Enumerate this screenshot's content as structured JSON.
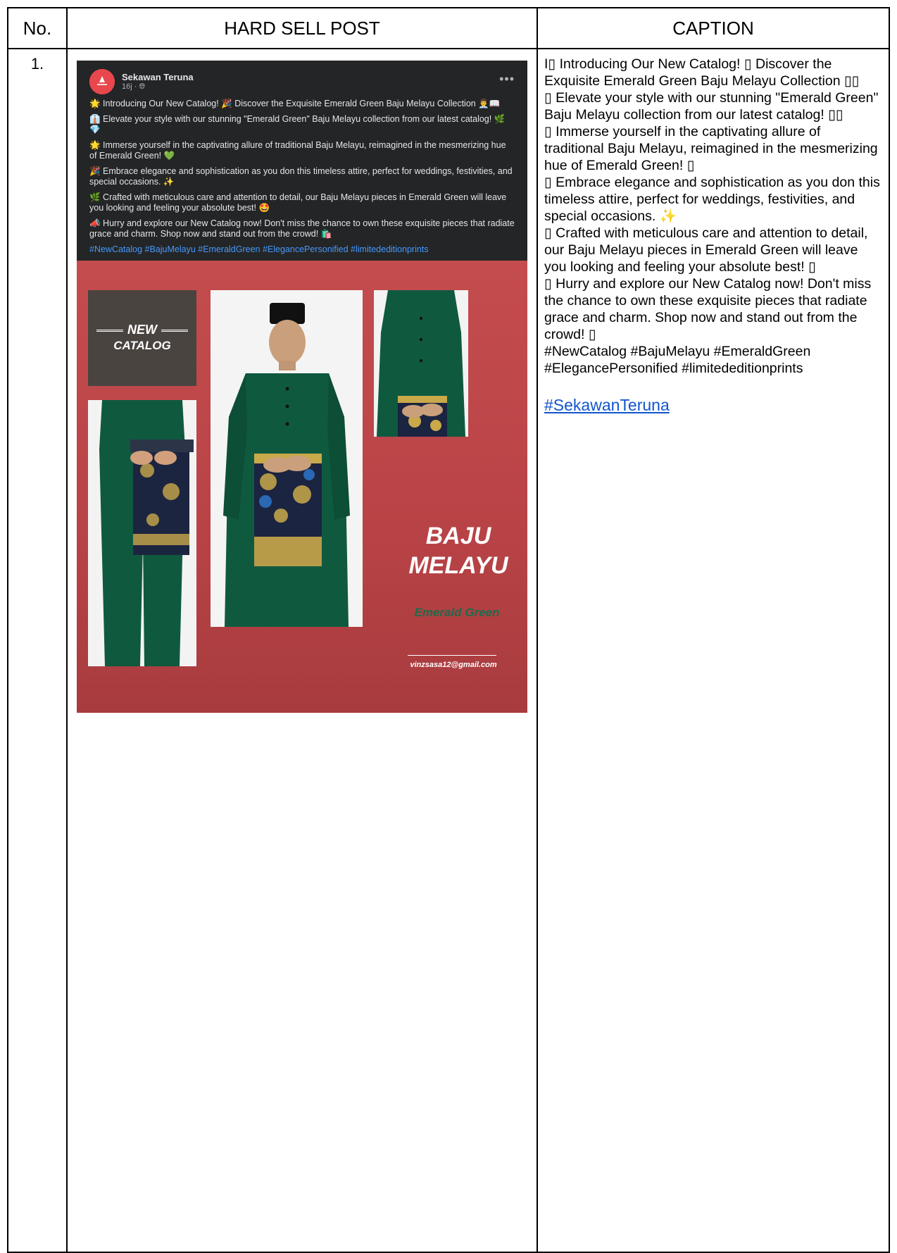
{
  "table": {
    "headers": {
      "no": "No.",
      "post": "HARD SELL POST",
      "caption": "CAPTION"
    },
    "row": {
      "no": "1."
    }
  },
  "post": {
    "page_name": "Sekawan Teruna",
    "avatar_text": "SEKAWAN TERUNA",
    "meta": "16j · ",
    "more": "•••",
    "paragraphs": [
      "🌟 Introducing Our New Catalog! 🎉 Discover the Exquisite Emerald Green Baju Melayu Collection 👨‍💼📖",
      "👔 Elevate your style with our stunning \"Emerald Green\" Baju Melayu collection from our latest catalog! 🌿💎",
      "🌟 Immerse yourself in the captivating allure of traditional Baju Melayu, reimagined in the mesmerizing hue of Emerald Green! 💚",
      "🎉 Embrace elegance and sophistication as you don this timeless attire, perfect for weddings, festivities, and special occasions. ✨",
      "🌿 Crafted with meticulous care and attention to detail, our Baju Melayu pieces in Emerald Green will leave you looking and feeling your absolute best! 🤩",
      "📣 Hurry and explore our New Catalog now! Don't miss the chance to own these exquisite pieces that radiate grace and charm. Shop now and stand out from the crowd! 🛍️"
    ],
    "hashtags": "#NewCatalog #BajuMelayu #EmeraldGreen #ElegancePersonified #limitededitionprints",
    "image": {
      "new": "NEW",
      "catalog": "CATALOG",
      "headline_1": "BAJU",
      "headline_2": "MELAYU",
      "subline": "Emerald Green",
      "email": "vinzsasa12@gmail.com"
    }
  },
  "caption": {
    "lines": [
      "I▯ Introducing Our New Catalog! ▯ Discover the Exquisite Emerald Green Baju Melayu Collection ▯▯",
      "▯ Elevate your style with our stunning \"Emerald Green\" Baju Melayu collection from our latest catalog! ▯▯",
      "▯ Immerse yourself in the captivating allure of traditional Baju Melayu, reimagined in the mesmerizing hue of Emerald Green! ▯",
      "▯ Embrace elegance and sophistication as you don this timeless attire, perfect for weddings, festivities, and special occasions. ✨",
      "▯ Crafted with meticulous care and attention to detail, our Baju Melayu pieces in Emerald Green will leave you looking and feeling your absolute best! ▯",
      "▯ Hurry and explore our New Catalog now! Don't miss the chance to own these exquisite pieces that radiate grace and charm. Shop now and stand out from the crowd! ▯",
      "#NewCatalog #BajuMelayu #EmeraldGreen #ElegancePersonified #limitededitionprints"
    ],
    "link": "#SekawanTeruna"
  },
  "colors": {
    "fb_background": "#242526",
    "hashtag_blue": "#4599ff",
    "poster_red": "#b84346",
    "emerald": "#0f5a3f",
    "link_blue": "#1155cc"
  }
}
